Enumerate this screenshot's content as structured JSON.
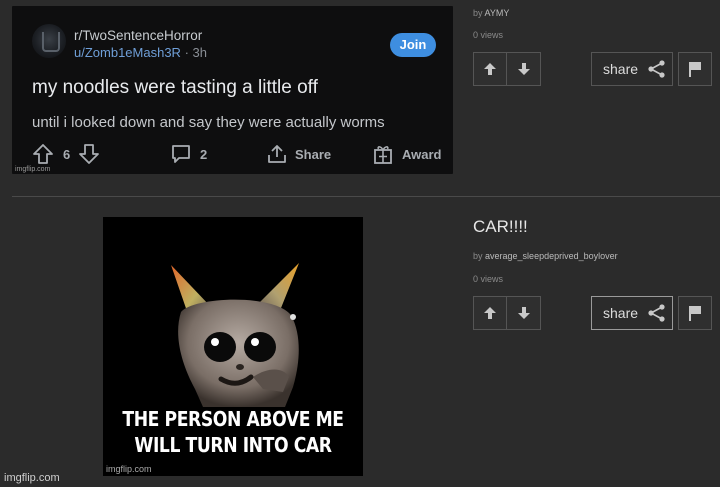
{
  "posts": [
    {
      "by_label": "by",
      "author": "AYMY",
      "views": "0 views",
      "share_label": "share",
      "image": {
        "subreddit": "r/TwoSentenceHorror",
        "username": "u/Zomb1eMash3R",
        "separator": "·",
        "age": "3h",
        "join_label": "Join",
        "title": "my noodles were tasting a little off",
        "body": "until i looked down and say they were actually worms",
        "upvotes": "6",
        "comments": "2",
        "share_label": "Share",
        "award_label": "Award",
        "watermark": "imgflip.com"
      }
    },
    {
      "title": "CAR!!!!",
      "by_label": "by",
      "author": "average_sleepdeprived_boylover",
      "views": "0 views",
      "share_label": "share",
      "image": {
        "caption": "THE PERSON ABOVE ME WILL TURN INTO CAR",
        "watermark": "imgflip.com"
      }
    }
  ],
  "site_watermark": "imgflip.com",
  "icons": {
    "upvote": "arrow-up-icon",
    "downvote": "arrow-down-icon",
    "share": "share-icon",
    "flag": "flag-icon"
  },
  "colors": {
    "background": "#2b2b2b",
    "reddit_join": "#3e8ee0",
    "reddit_link": "#6f9fd8"
  }
}
